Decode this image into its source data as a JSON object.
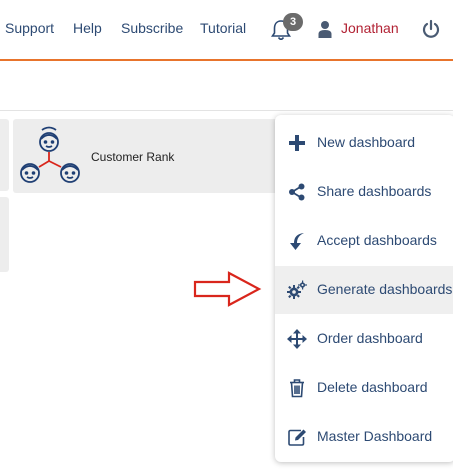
{
  "header": {
    "links": [
      "Support",
      "Help",
      "Subscribe",
      "Tutorial"
    ],
    "notifications_count": "3",
    "user_name": "Jonathan",
    "colors": {
      "accent_line": "#e8742c",
      "link": "#2d4a73",
      "user": "#b22234"
    }
  },
  "dashboard_tile": {
    "label": "Customer Rank",
    "icon": "customer-network-icon"
  },
  "menu": {
    "items": [
      {
        "label": "New dashboard",
        "icon": "plus-icon"
      },
      {
        "label": "Share dashboards",
        "icon": "share-icon"
      },
      {
        "label": "Accept dashboards",
        "icon": "accept-curved-arrow-icon"
      },
      {
        "label": "Generate dashboards",
        "icon": "gears-icon",
        "highlighted": true
      },
      {
        "label": "Order dashboard",
        "icon": "move-arrows-icon"
      },
      {
        "label": "Delete dashboard",
        "icon": "trash-icon"
      },
      {
        "label": "Master Dashboard",
        "icon": "edit-icon"
      }
    ]
  },
  "annotation": {
    "icon": "red-outline-arrow-icon",
    "color": "#d9261c"
  }
}
